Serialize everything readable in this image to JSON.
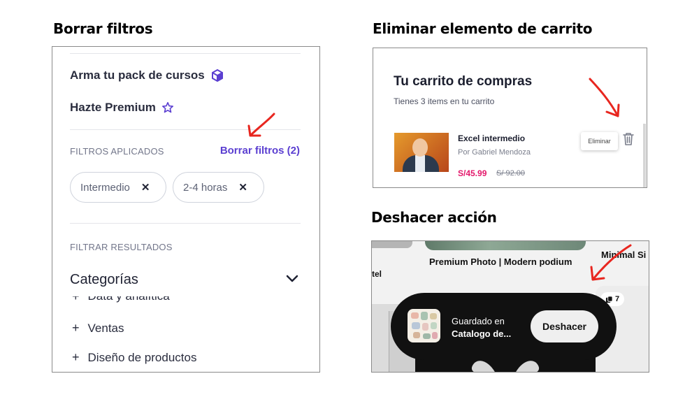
{
  "sections": {
    "filters_title": "Borrar filtros",
    "cart_title": "Eliminar elemento de carrito",
    "undo_title": "Deshacer acción"
  },
  "filters_panel": {
    "menu": [
      {
        "label": "Arma tu pack de cursos",
        "icon": "cube-icon"
      },
      {
        "label": "Hazte Premium",
        "icon": "star-icon"
      }
    ],
    "applied_heading": "FILTROS APLICADOS",
    "clear_link": "Borrar filtros (2)",
    "chips": [
      {
        "label": "Intermedio",
        "remove": "✕"
      },
      {
        "label": "2-4 horas",
        "remove": "✕"
      }
    ],
    "filter_heading": "FILTRAR RESULTADOS",
    "categories_title": "Categorías",
    "category_items": [
      {
        "label": "Data y analítica"
      },
      {
        "label": "Ventas"
      },
      {
        "label": "Diseño de productos"
      }
    ],
    "plus": "+"
  },
  "cart_panel": {
    "title": "Tu carrito de compras",
    "subtitle": "Tienes 3 items en tu carrito",
    "item": {
      "name": "Excel intermedio",
      "author": "Por Gabriel Mendoza",
      "price": "S/45.99",
      "old_price": "S/ 92.00"
    },
    "tooltip": "Eliminar"
  },
  "undo_panel": {
    "center_label": "Premium Photo | Modern podium",
    "left_label": "tel",
    "right_label": "Minimal Si",
    "badge_count": "7",
    "toast": {
      "line1": "Guardado en",
      "line2": "Catalogo de...",
      "button": "Deshacer"
    }
  },
  "colors": {
    "accent_purple": "#5b3fd1",
    "price_pink": "#e3186b",
    "annotation_red": "#e8261f",
    "toast_bg": "#111111"
  }
}
